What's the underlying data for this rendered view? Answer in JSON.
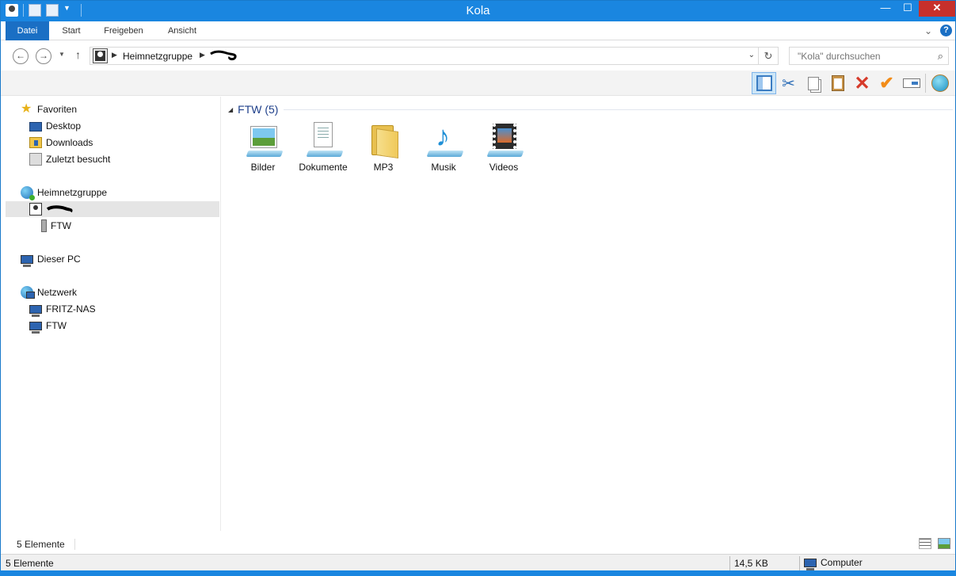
{
  "window": {
    "title": "Kola"
  },
  "ribbon": {
    "tabs": [
      "Datei",
      "Start",
      "Freigeben",
      "Ansicht"
    ],
    "help": "?"
  },
  "window_buttons": {
    "minimize": "—",
    "maximize": "☐",
    "close": "✕"
  },
  "address": {
    "crumb": "Heimnetzgruppe",
    "search_placeholder": "\"Kola\" durchsuchen"
  },
  "nav": {
    "favorites": {
      "label": "Favoriten",
      "items": [
        "Desktop",
        "Downloads",
        "Zuletzt besucht"
      ]
    },
    "homegroup": {
      "label": "Heimnetzgruppe",
      "child": "FTW"
    },
    "this_pc": "Dieser PC",
    "network": {
      "label": "Netzwerk",
      "items": [
        "FRITZ-NAS",
        "FTW"
      ]
    }
  },
  "content": {
    "group_header": "FTW (5)",
    "items": [
      {
        "label": "Bilder",
        "icon": "pictures-library-icon"
      },
      {
        "label": "Dokumente",
        "icon": "documents-library-icon"
      },
      {
        "label": "MP3",
        "icon": "folder-icon"
      },
      {
        "label": "Musik",
        "icon": "music-library-icon"
      },
      {
        "label": "Videos",
        "icon": "videos-library-icon"
      }
    ]
  },
  "status": {
    "item_count": "5 Elemente",
    "bar_count": "5 Elemente",
    "size": "14,5 KB",
    "zone": "Computer"
  },
  "colors": {
    "accent": "#1a86e0",
    "file_tab": "#1a6fc4",
    "group_header": "#1e3f8a"
  }
}
